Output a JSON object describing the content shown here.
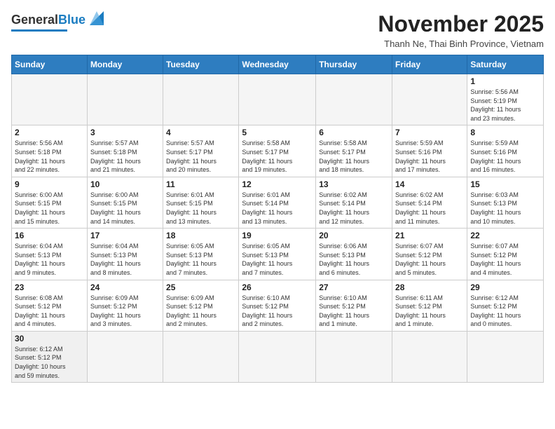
{
  "header": {
    "logo_general": "General",
    "logo_blue": "Blue",
    "month_title": "November 2025",
    "location": "Thanh Ne, Thai Binh Province, Vietnam"
  },
  "weekdays": [
    "Sunday",
    "Monday",
    "Tuesday",
    "Wednesday",
    "Thursday",
    "Friday",
    "Saturday"
  ],
  "days": [
    {
      "num": "",
      "info": ""
    },
    {
      "num": "",
      "info": ""
    },
    {
      "num": "",
      "info": ""
    },
    {
      "num": "",
      "info": ""
    },
    {
      "num": "",
      "info": ""
    },
    {
      "num": "",
      "info": ""
    },
    {
      "num": "1",
      "info": "Sunrise: 5:56 AM\nSunset: 5:19 PM\nDaylight: 11 hours\nand 23 minutes."
    },
    {
      "num": "2",
      "info": "Sunrise: 5:56 AM\nSunset: 5:18 PM\nDaylight: 11 hours\nand 22 minutes."
    },
    {
      "num": "3",
      "info": "Sunrise: 5:57 AM\nSunset: 5:18 PM\nDaylight: 11 hours\nand 21 minutes."
    },
    {
      "num": "4",
      "info": "Sunrise: 5:57 AM\nSunset: 5:17 PM\nDaylight: 11 hours\nand 20 minutes."
    },
    {
      "num": "5",
      "info": "Sunrise: 5:58 AM\nSunset: 5:17 PM\nDaylight: 11 hours\nand 19 minutes."
    },
    {
      "num": "6",
      "info": "Sunrise: 5:58 AM\nSunset: 5:17 PM\nDaylight: 11 hours\nand 18 minutes."
    },
    {
      "num": "7",
      "info": "Sunrise: 5:59 AM\nSunset: 5:16 PM\nDaylight: 11 hours\nand 17 minutes."
    },
    {
      "num": "8",
      "info": "Sunrise: 5:59 AM\nSunset: 5:16 PM\nDaylight: 11 hours\nand 16 minutes."
    },
    {
      "num": "9",
      "info": "Sunrise: 6:00 AM\nSunset: 5:15 PM\nDaylight: 11 hours\nand 15 minutes."
    },
    {
      "num": "10",
      "info": "Sunrise: 6:00 AM\nSunset: 5:15 PM\nDaylight: 11 hours\nand 14 minutes."
    },
    {
      "num": "11",
      "info": "Sunrise: 6:01 AM\nSunset: 5:15 PM\nDaylight: 11 hours\nand 13 minutes."
    },
    {
      "num": "12",
      "info": "Sunrise: 6:01 AM\nSunset: 5:14 PM\nDaylight: 11 hours\nand 13 minutes."
    },
    {
      "num": "13",
      "info": "Sunrise: 6:02 AM\nSunset: 5:14 PM\nDaylight: 11 hours\nand 12 minutes."
    },
    {
      "num": "14",
      "info": "Sunrise: 6:02 AM\nSunset: 5:14 PM\nDaylight: 11 hours\nand 11 minutes."
    },
    {
      "num": "15",
      "info": "Sunrise: 6:03 AM\nSunset: 5:13 PM\nDaylight: 11 hours\nand 10 minutes."
    },
    {
      "num": "16",
      "info": "Sunrise: 6:04 AM\nSunset: 5:13 PM\nDaylight: 11 hours\nand 9 minutes."
    },
    {
      "num": "17",
      "info": "Sunrise: 6:04 AM\nSunset: 5:13 PM\nDaylight: 11 hours\nand 8 minutes."
    },
    {
      "num": "18",
      "info": "Sunrise: 6:05 AM\nSunset: 5:13 PM\nDaylight: 11 hours\nand 7 minutes."
    },
    {
      "num": "19",
      "info": "Sunrise: 6:05 AM\nSunset: 5:13 PM\nDaylight: 11 hours\nand 7 minutes."
    },
    {
      "num": "20",
      "info": "Sunrise: 6:06 AM\nSunset: 5:13 PM\nDaylight: 11 hours\nand 6 minutes."
    },
    {
      "num": "21",
      "info": "Sunrise: 6:07 AM\nSunset: 5:12 PM\nDaylight: 11 hours\nand 5 minutes."
    },
    {
      "num": "22",
      "info": "Sunrise: 6:07 AM\nSunset: 5:12 PM\nDaylight: 11 hours\nand 4 minutes."
    },
    {
      "num": "23",
      "info": "Sunrise: 6:08 AM\nSunset: 5:12 PM\nDaylight: 11 hours\nand 4 minutes."
    },
    {
      "num": "24",
      "info": "Sunrise: 6:09 AM\nSunset: 5:12 PM\nDaylight: 11 hours\nand 3 minutes."
    },
    {
      "num": "25",
      "info": "Sunrise: 6:09 AM\nSunset: 5:12 PM\nDaylight: 11 hours\nand 2 minutes."
    },
    {
      "num": "26",
      "info": "Sunrise: 6:10 AM\nSunset: 5:12 PM\nDaylight: 11 hours\nand 2 minutes."
    },
    {
      "num": "27",
      "info": "Sunrise: 6:10 AM\nSunset: 5:12 PM\nDaylight: 11 hours\nand 1 minute."
    },
    {
      "num": "28",
      "info": "Sunrise: 6:11 AM\nSunset: 5:12 PM\nDaylight: 11 hours\nand 1 minute."
    },
    {
      "num": "29",
      "info": "Sunrise: 6:12 AM\nSunset: 5:12 PM\nDaylight: 11 hours\nand 0 minutes."
    },
    {
      "num": "30",
      "info": "Sunrise: 6:12 AM\nSunset: 5:12 PM\nDaylight: 10 hours\nand 59 minutes."
    },
    {
      "num": "",
      "info": ""
    },
    {
      "num": "",
      "info": ""
    },
    {
      "num": "",
      "info": ""
    },
    {
      "num": "",
      "info": ""
    },
    {
      "num": "",
      "info": ""
    },
    {
      "num": "",
      "info": ""
    }
  ]
}
